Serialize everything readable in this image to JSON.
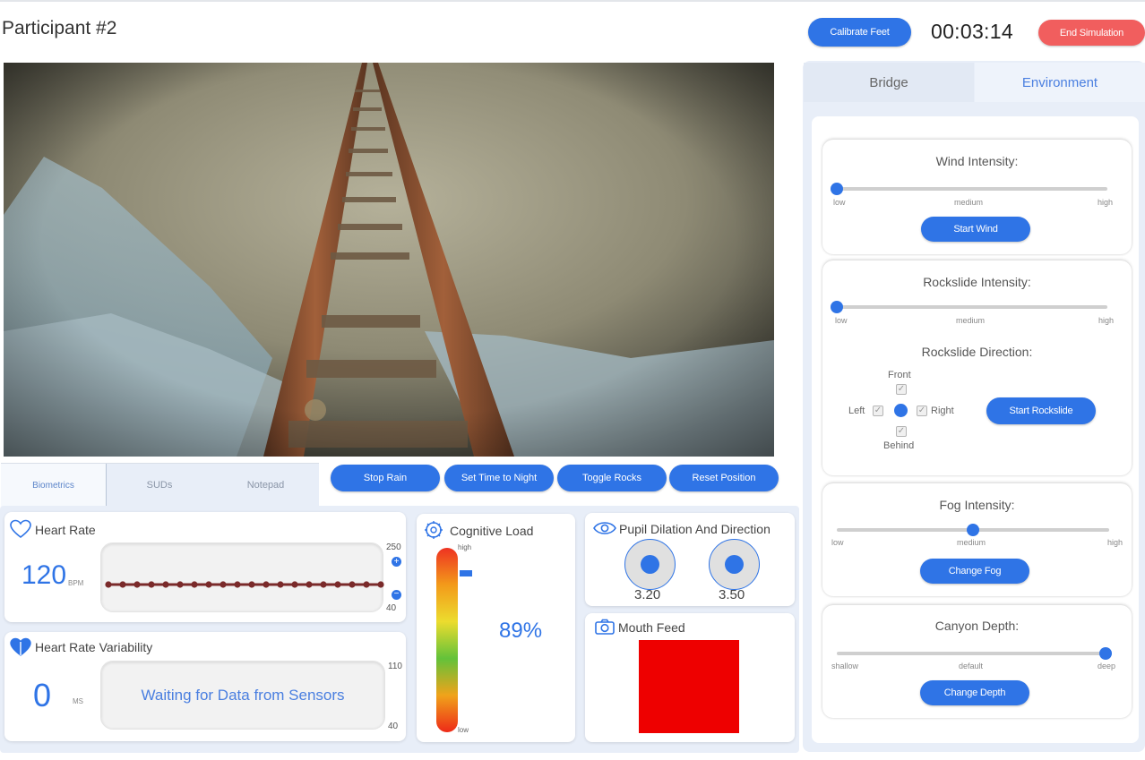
{
  "header": {
    "participant": "Participant #2",
    "calibrate_label": "Calibrate Feet",
    "timer": "00:03:14",
    "end_label": "End Simulation"
  },
  "bottom_tabs": [
    "Biometrics",
    "SUDs",
    "Notepad"
  ],
  "actions": {
    "stop_rain": "Stop Rain",
    "night": "Set Time to Night",
    "rocks": "Toggle Rocks",
    "reset": "Reset Position"
  },
  "heart_rate": {
    "title": "Heart Rate",
    "value": "120",
    "unit": "BPM",
    "ymax": "250",
    "ymin": "40",
    "zoom_in": "+",
    "zoom_out": "−"
  },
  "hrv": {
    "title": "Heart Rate Variability",
    "value": "0",
    "unit": "MS",
    "waiting": "Waiting for Data from Sensors",
    "ymax": "110",
    "ymin": "40"
  },
  "cognitive_load": {
    "title": "Cognitive Load",
    "high": "high",
    "low": "low",
    "percent": "89%",
    "level": 0.89
  },
  "pupil": {
    "title": "Pupil Dilation And Direction",
    "left": "3.20",
    "right": "3.50"
  },
  "mouth": {
    "title": "Mouth Feed",
    "color": "#ee0000"
  },
  "right_tabs": {
    "bridge": "Bridge",
    "environment": "Environment"
  },
  "wind": {
    "title": "Wind Intensity:",
    "low": "low",
    "mid": "medium",
    "high": "high",
    "level": 0.0,
    "button": "Start Wind"
  },
  "rockslide": {
    "title": "Rockslide Intensity:",
    "low": "low",
    "mid": "medium",
    "high": "high",
    "level": 0.0,
    "direction_title": "Rockslide Direction:",
    "front": "Front",
    "left": "Left",
    "right": "Right",
    "behind": "Behind",
    "check": "✓",
    "button": "Start Rockslide"
  },
  "fog": {
    "title": "Fog Intensity:",
    "low": "low",
    "mid": "medium",
    "high": "high",
    "level": 0.5,
    "button": "Change Fog"
  },
  "depth": {
    "title": "Canyon Depth:",
    "low": "shallow",
    "mid": "default",
    "high": "deep",
    "level": 1.0,
    "button": "Change Depth"
  },
  "colors": {
    "accent": "#2f74e6",
    "danger": "#f15e5e",
    "hr_line": "#7a2a2a"
  }
}
